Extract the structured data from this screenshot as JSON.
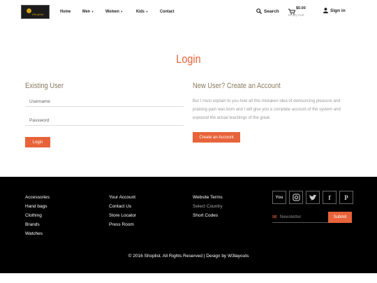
{
  "header": {
    "logo_text": "Shoplist",
    "nav": [
      {
        "label": "Home",
        "caret": false
      },
      {
        "label": "Men",
        "caret": true
      },
      {
        "label": "Women",
        "caret": true
      },
      {
        "label": "Kids",
        "caret": true
      },
      {
        "label": "Contact",
        "caret": false
      }
    ],
    "search_label": "Search",
    "cart_price": "$0.00",
    "cart_status": "Empty Cart",
    "signin_label": "Sign in"
  },
  "main": {
    "title": "Login",
    "existing_title": "Existing User",
    "username_placeholder": "Username",
    "password_placeholder": "Password",
    "login_button": "Login",
    "new_user_title": "New User? Create an Account",
    "new_user_text": "But I must explain to you how all this mistaken idea of denouncing pleasure and praising pain was born and I will give you a complete account of the system and expound the actual teachings of the great.",
    "create_button": "Create an Account"
  },
  "footer": {
    "col1": [
      "Accessories",
      "Hand bags",
      "Clothing",
      "Brands",
      "Watches"
    ],
    "col2": [
      "Your Account",
      "Contact Us",
      "Store Locator",
      "Press Room"
    ],
    "col3": [
      "Website Terms",
      "Select Country",
      "Short Codes"
    ],
    "newsletter_placeholder": "Newsletter",
    "submit_label": "Submit",
    "copyright": "© 2016 Shoplist. All Rights Reserved | Design by W3layouts"
  },
  "colors": {
    "accent": "#e8633a",
    "footer_bg": "#000000",
    "heading": "#8a7a5e"
  }
}
